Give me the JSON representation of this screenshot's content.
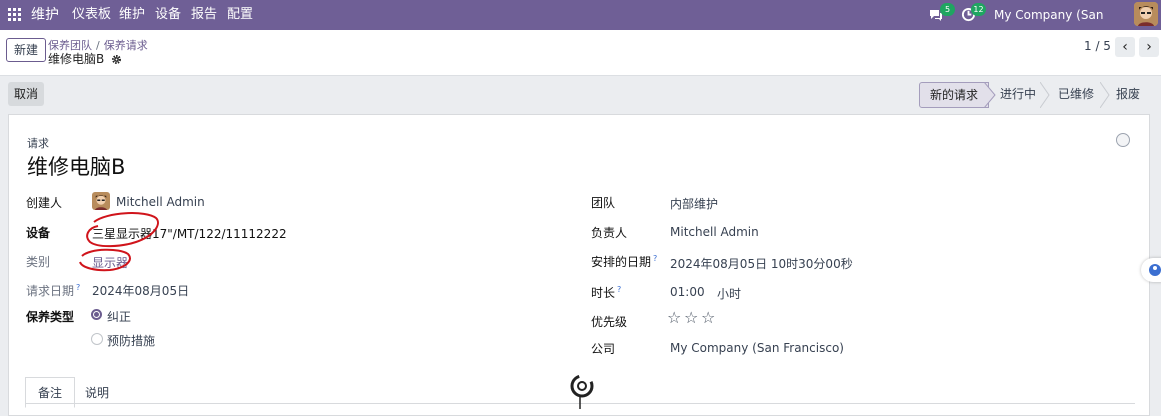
{
  "topbar": {
    "app_name": "维护",
    "menu": [
      "仪表板",
      "维护",
      "设备",
      "报告",
      "配置"
    ],
    "chat_count": "5",
    "activity_count": "12",
    "company": "My Company (San Francisco)"
  },
  "control_panel": {
    "new_label": "新建",
    "breadcrumb": [
      "保养团队",
      "保养请求"
    ],
    "record_name": "维修电脑B",
    "pager": "1 / 5"
  },
  "actions": {
    "cancel_label": "取消",
    "stages": [
      "新的请求",
      "进行中",
      "已维修",
      "报废"
    ],
    "active_stage": "新的请求"
  },
  "form": {
    "request_label": "请求",
    "title": "维修电脑B",
    "left": {
      "creator_label": "创建人",
      "creator_value": "Mitchell Admin",
      "equipment_label": "设备",
      "equipment_value": "三星显示器17\"/MT/122/11112222",
      "category_label": "类别",
      "category_value": "显示器",
      "date_label": "请求日期",
      "date_value": "2024年08月05日",
      "type_label": "保养类型",
      "type_options": [
        "纠正",
        "预防措施"
      ],
      "type_selected": "纠正"
    },
    "right": {
      "team_label": "团队",
      "team_value": "内部维护",
      "owner_label": "负责人",
      "owner_value": "Mitchell Admin",
      "schedule_label": "安排的日期",
      "schedule_value": "2024年08月05日 10时30分00秒",
      "duration_label": "时长",
      "duration_value": "01:00",
      "duration_unit": "小时",
      "priority_label": "优先级",
      "priority_stars": 0,
      "priority_max": 3,
      "company_label": "公司",
      "company_value": "My Company (San Francisco)"
    },
    "tabs": [
      "备注",
      "说明"
    ]
  }
}
